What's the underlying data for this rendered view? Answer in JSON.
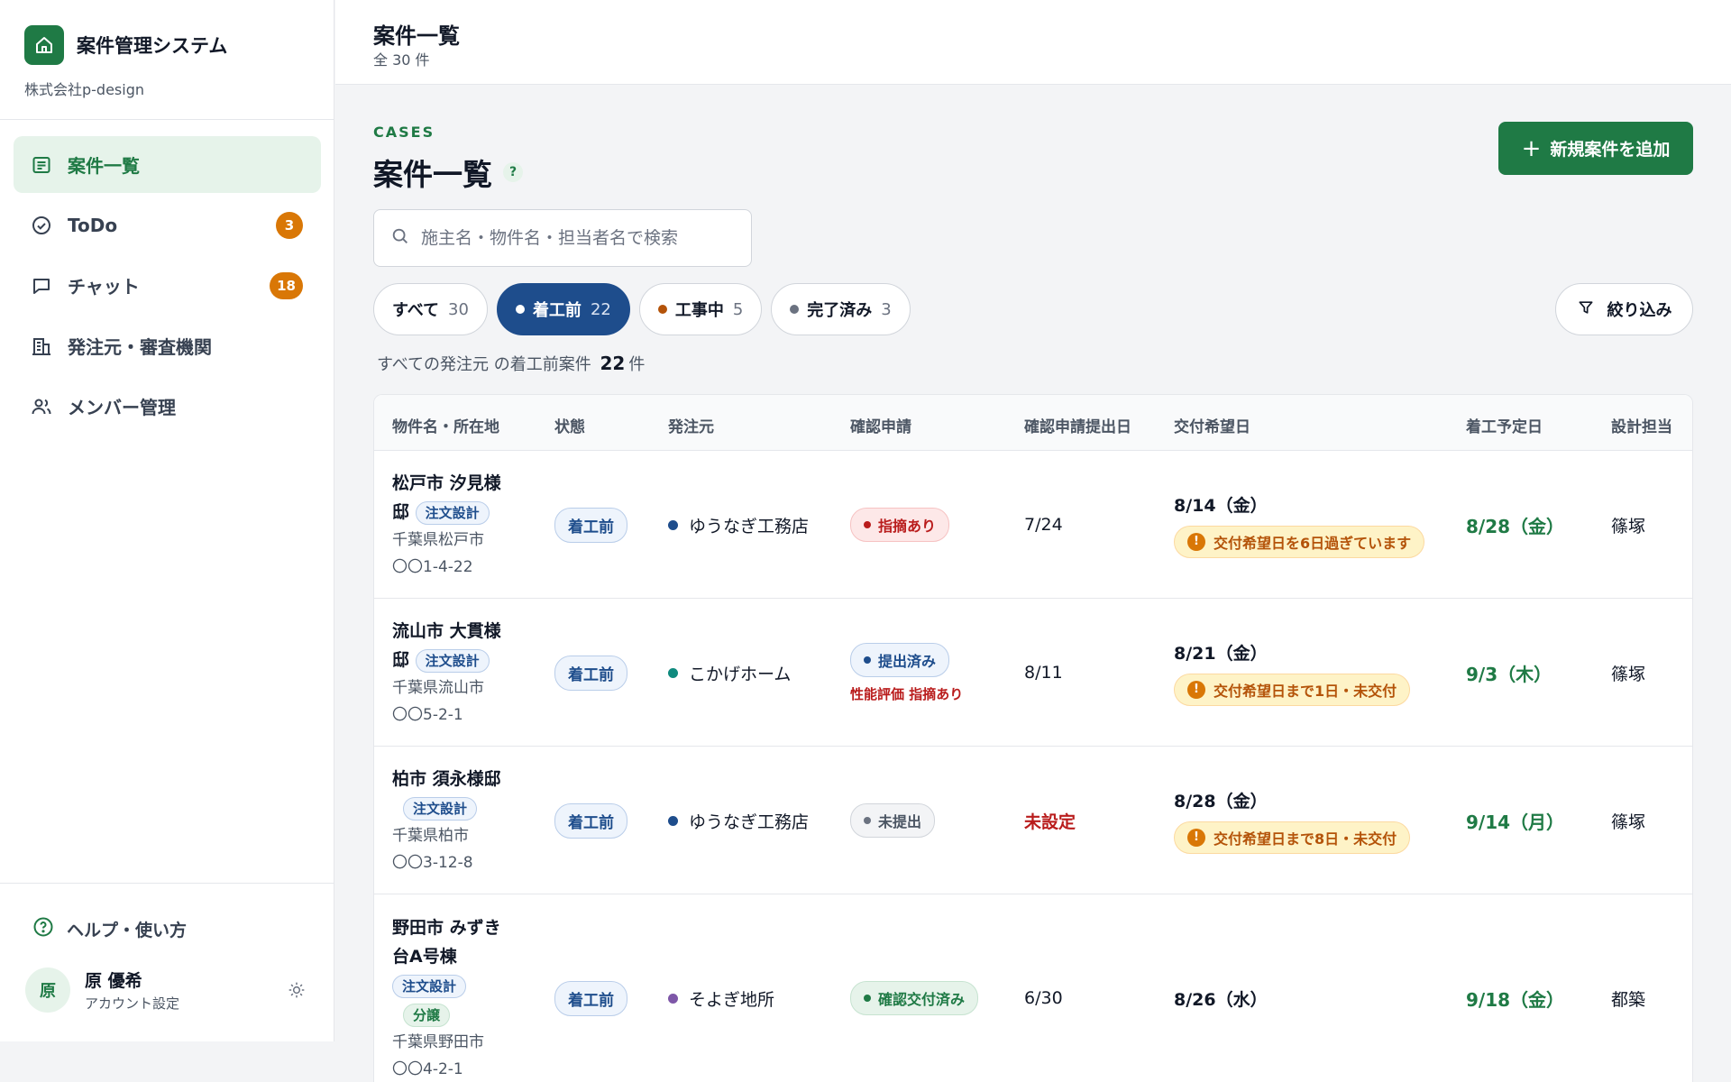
{
  "brand": {
    "title": "案件管理システム",
    "company": "株式会社p-design"
  },
  "nav": [
    {
      "label": "案件一覧",
      "icon": "list-icon",
      "active": true,
      "badge": ""
    },
    {
      "label": "ToDo",
      "icon": "check-circle-icon",
      "active": false,
      "badge": "3"
    },
    {
      "label": "チャット",
      "icon": "chat-icon",
      "active": false,
      "badge": "18"
    },
    {
      "label": "発注元・審査機関",
      "icon": "building-icon",
      "active": false,
      "badge": ""
    },
    {
      "label": "メンバー管理",
      "icon": "users-icon",
      "active": false,
      "badge": ""
    }
  ],
  "help": {
    "label": "ヘルプ・使い方"
  },
  "user": {
    "initial": "原",
    "name": "原 優希",
    "sub": "アカウント設定"
  },
  "header": {
    "title": "案件一覧",
    "count": "全 30 件"
  },
  "page": {
    "section": "CASES",
    "title": "案件一覧",
    "help": "?",
    "add_label": "新規案件を追加"
  },
  "search": {
    "placeholder": "施主名・物件名・担当者名で検索"
  },
  "tabs": [
    {
      "label": "すべて",
      "count": "30",
      "dot": ""
    },
    {
      "label": "着工前",
      "count": "22",
      "dot": "#ffffff"
    },
    {
      "label": "工事中",
      "count": "5",
      "dot": "#b45309"
    },
    {
      "label": "完了済み",
      "count": "3",
      "dot": "#6b7280"
    }
  ],
  "filter": {
    "label": "絞り込み"
  },
  "summary": {
    "prefix": "すべての発注元 の着工前案件",
    "count": "22",
    "suffix": "件"
  },
  "table": {
    "headers": [
      "物件名・所在地",
      "状態",
      "発注元",
      "確認申請",
      "確認申請提出日",
      "交付希望日",
      "着工予定日",
      "設計担当"
    ],
    "rows": [
      {
        "name1": "松戸市 汐見様",
        "name2": "邸",
        "tags": [
          "注文設計"
        ],
        "addr1": "千葉県松戸市",
        "addr2": "〇〇1-4-22",
        "status": "着工前",
        "client": "ゆうなぎ工務店",
        "client_color": "#1e4d8c",
        "confirm": "指摘あり",
        "confirm_kind": "red",
        "confirm_sub": "",
        "submit": "7/24",
        "submit_kind": "normal",
        "delivery": "8/14（金）",
        "warning": "交付希望日を6日過ぎています",
        "start": "8/28（金）",
        "designer": "篠塚"
      },
      {
        "name1": "流山市 大貫様",
        "name2": "邸",
        "tags": [
          "注文設計"
        ],
        "addr1": "千葉県流山市",
        "addr2": "〇〇5-2-1",
        "status": "着工前",
        "client": "こかげホーム",
        "client_color": "#0f8a7e",
        "confirm": "提出済み",
        "confirm_kind": "blue",
        "confirm_sub": "性能評価 指摘あり",
        "submit": "8/11",
        "submit_kind": "normal",
        "delivery": "8/21（金）",
        "warning": "交付希望日まで1日・未交付",
        "start": "9/3（木）",
        "designer": "篠塚"
      },
      {
        "name1": "柏市 須永様邸",
        "name2": "",
        "tags": [
          "注文設計"
        ],
        "addr1": "千葉県柏市",
        "addr2": "〇〇3-12-8",
        "status": "着工前",
        "client": "ゆうなぎ工務店",
        "client_color": "#1e4d8c",
        "confirm": "未提出",
        "confirm_kind": "gray",
        "confirm_sub": "",
        "submit": "未設定",
        "submit_kind": "red",
        "delivery": "8/28（金）",
        "warning": "交付希望日まで8日・未交付",
        "start": "9/14（月）",
        "designer": "篠塚"
      },
      {
        "name1": "野田市 みずき",
        "name2": "台A号棟",
        "tags": [
          "注文設計",
          "分譲"
        ],
        "addr1": "千葉県野田市",
        "addr2": "〇〇4-2-1",
        "status": "着工前",
        "client": "そよぎ地所",
        "client_color": "#7e57a8",
        "confirm": "確認交付済み",
        "confirm_kind": "green",
        "confirm_sub": "",
        "submit": "6/30",
        "submit_kind": "normal",
        "delivery": "8/26（水）",
        "warning": "",
        "start": "9/18（金）",
        "designer": "都築"
      }
    ]
  },
  "colors": {
    "brand_green": "#1f7a45",
    "active_tab": "#1e4d8c",
    "badge_orange": "#d97706",
    "warn_text": "#b45309",
    "alert_red": "#b91c1c"
  }
}
